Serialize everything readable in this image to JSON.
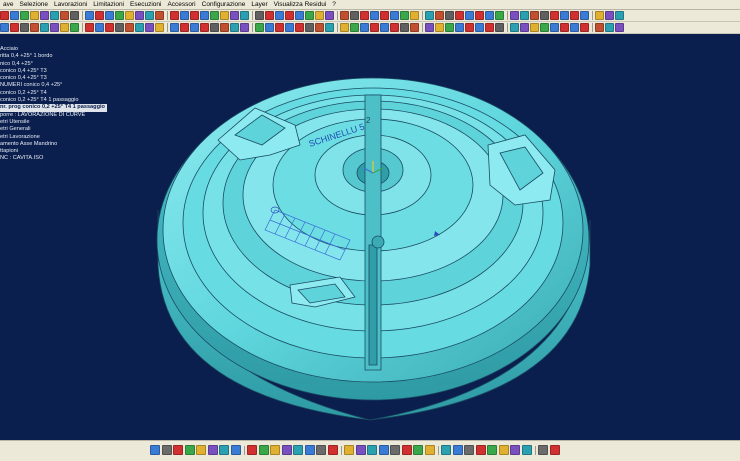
{
  "menubar": {
    "items": [
      "ave",
      "Selezione",
      "Lavorazioni",
      "Limitazioni",
      "Esecuzioni",
      "Accessori",
      "Configurazione",
      "Layer",
      "Visualizza Residui",
      "?"
    ]
  },
  "tree": {
    "items": [
      "Acciaio",
      "ritta 0,4 +25° 1 bordo",
      "nico 0,4 +25°",
      "conico 0,4 +25° T3",
      "conico 0,4 +25° T3",
      "NUMERI conico 0,4 +25°",
      "conico 0,2 +25° T4",
      "conico 0,2 +25° T4 1 passaggio",
      "nr. prog conico 0,2 +25° T4 1 passaggio",
      "porre : LAVORAZIONE DI CURVE",
      "etri Utensile",
      "etri Generali",
      "etri Lavorazione",
      "amento Asse Mandrino",
      "ttapioni",
      "NC : CAVITA.ISO"
    ],
    "selected_index": 8
  },
  "model": {
    "engraving": "SCHINELLU 5",
    "label_number": "2",
    "colors": {
      "background": "#0b1f4e",
      "body": "#5fd6dd",
      "body_light": "#8deaf0",
      "body_dark": "#3aaab3",
      "edge": "#1a4b63",
      "toolpath": "#3a6fd8"
    }
  },
  "toolbars": {
    "top_icon_colors": [
      "#d03030",
      "#3a7bd5",
      "#3aa84a",
      "#e0b030",
      "#7a4fc0",
      "#2aa0b0",
      "#c05030",
      "#606060",
      "#d03030",
      "#3a7bd5"
    ],
    "bottom_icon_colors": [
      "#3a7bd5",
      "#6b6b6b",
      "#d03030",
      "#3aa84a",
      "#e0b030",
      "#7a4fc0",
      "#2aa0b0"
    ]
  }
}
